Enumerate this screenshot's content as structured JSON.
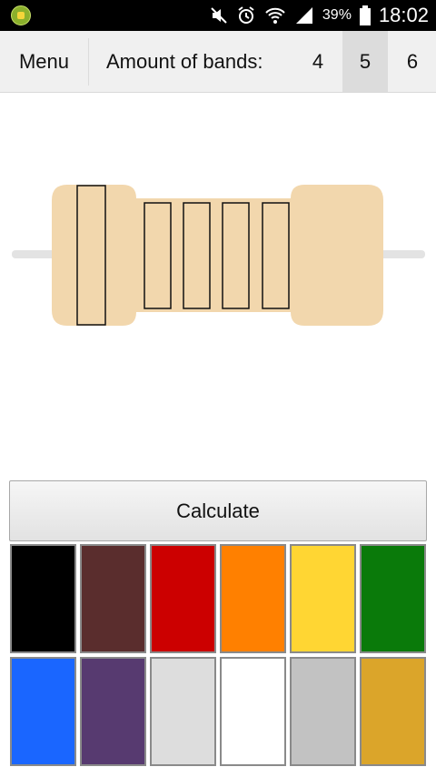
{
  "status_bar": {
    "battery": "39%",
    "time": "18:02",
    "icons": [
      "app-notification-icon",
      "mute-icon",
      "alarm-icon",
      "wifi-icon",
      "signal-icon",
      "battery-icon"
    ]
  },
  "toolbar": {
    "menu_label": "Menu",
    "bands_label": "Amount of bands:",
    "band_options": [
      "4",
      "5",
      "6"
    ],
    "selected_band_option": "5"
  },
  "resistor": {
    "body_color": "#f2d7ad",
    "lead_color": "#e3e3e3",
    "band_count": 5,
    "band_fill": "#f2d7ad",
    "band_outline": "#111111"
  },
  "calculate_label": "Calculate",
  "palette": [
    {
      "name": "black",
      "color": "#000000"
    },
    {
      "name": "brown",
      "color": "#5a2d2d"
    },
    {
      "name": "red",
      "color": "#cc0000"
    },
    {
      "name": "orange",
      "color": "#ff8000"
    },
    {
      "name": "yellow",
      "color": "#ffd633"
    },
    {
      "name": "green",
      "color": "#0a7a0a"
    },
    {
      "name": "blue",
      "color": "#1a66ff"
    },
    {
      "name": "violet",
      "color": "#573a70"
    },
    {
      "name": "grey",
      "color": "#dddddd"
    },
    {
      "name": "white",
      "color": "#ffffff"
    },
    {
      "name": "silver",
      "color": "#c2c2c2"
    },
    {
      "name": "gold",
      "color": "#dba52a"
    }
  ]
}
